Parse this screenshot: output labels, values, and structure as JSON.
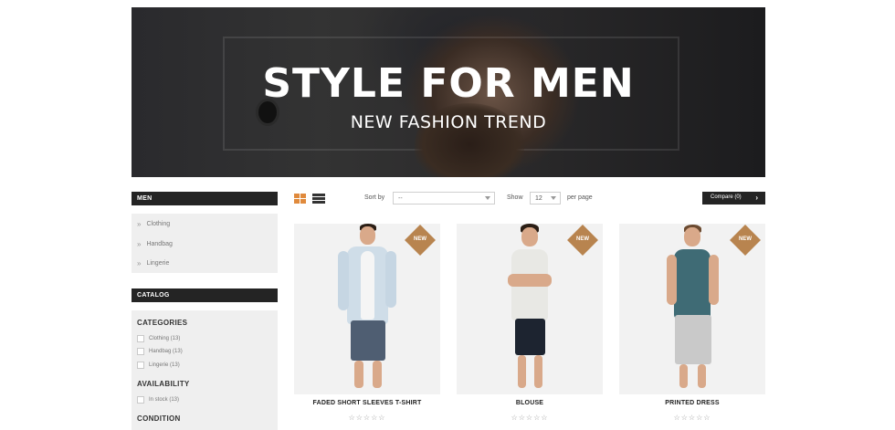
{
  "banner": {
    "title": "STYLE FOR MEN",
    "subtitle": "NEW FASHION TREND"
  },
  "sidebar": {
    "men": {
      "heading": "MEN",
      "items": [
        {
          "label": "Clothing"
        },
        {
          "label": "Handbag"
        },
        {
          "label": "Lingerie"
        }
      ]
    },
    "catalog": {
      "heading": "CATALOG",
      "categories_title": "CATEGORIES",
      "categories": [
        {
          "label": "Clothing (13)"
        },
        {
          "label": "Handbag (13)"
        },
        {
          "label": "Lingerie (13)"
        }
      ],
      "availability_title": "AVAILABILITY",
      "availability": [
        {
          "label": "In stock (13)"
        }
      ],
      "condition_title": "CONDITION"
    }
  },
  "toolbar": {
    "sort_label": "Sort by",
    "sort_value": "--",
    "show_label": "Show",
    "show_value": "12",
    "per_page_label": "per page",
    "compare_label": "Compare (0)",
    "grid_icon": "grid-view-icon",
    "list_icon": "list-view-icon"
  },
  "products": [
    {
      "name": "FADED SHORT SLEEVES T-SHIRT",
      "badge": "NEW",
      "rating": "☆☆☆☆☆"
    },
    {
      "name": "BLOUSE",
      "badge": "NEW",
      "rating": "☆☆☆☆☆"
    },
    {
      "name": "PRINTED DRESS",
      "badge": "NEW",
      "rating": "☆☆☆☆☆"
    }
  ],
  "colors": {
    "accent": "#e08a3c",
    "badge": "#b8844f",
    "dark": "#242424",
    "panel": "#efefef"
  }
}
